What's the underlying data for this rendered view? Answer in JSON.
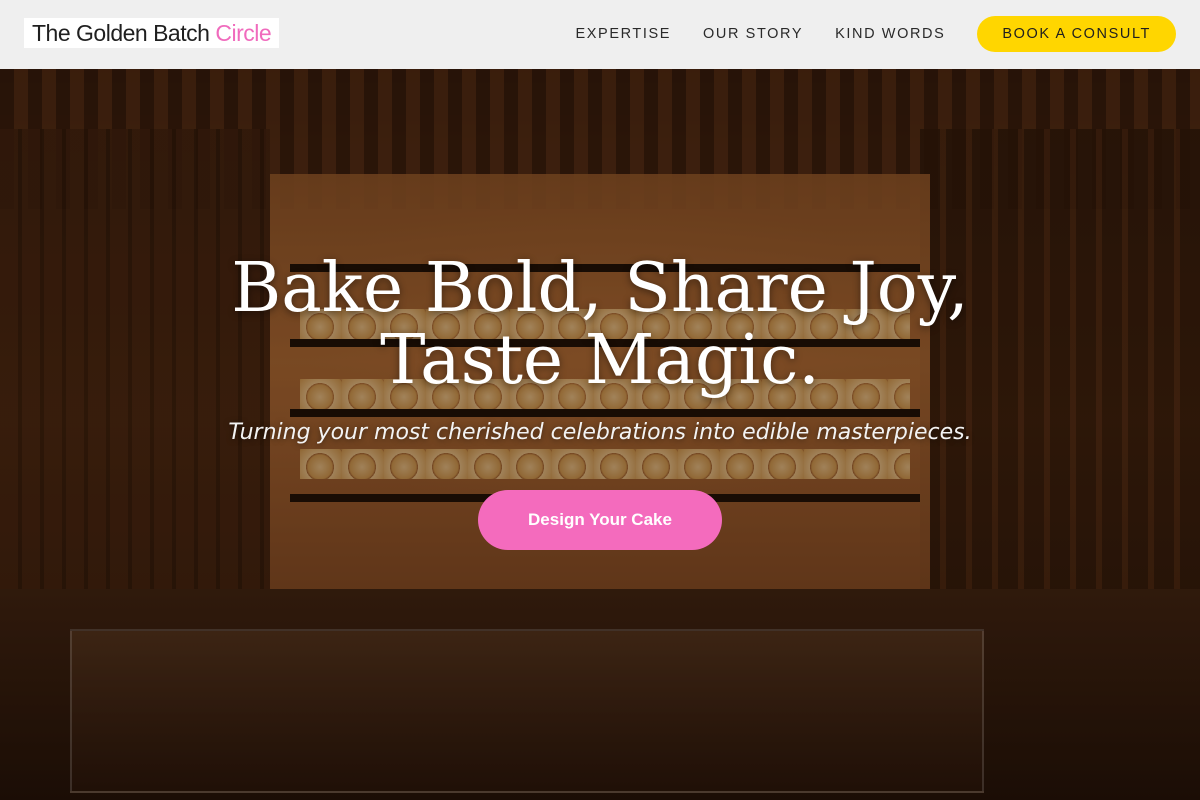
{
  "brand": {
    "name_main": "The Golden Batch",
    "name_accent": "Circle",
    "accent_color": "#f06bbd"
  },
  "nav": {
    "links": [
      {
        "label": "EXPERTISE"
      },
      {
        "label": "OUR STORY"
      },
      {
        "label": "KIND WORDS"
      }
    ],
    "cta_label": "BOOK A CONSULT",
    "cta_color": "#ffd600"
  },
  "hero": {
    "title_line1": "Bake Bold, Share Joy,",
    "title_line2": "Taste Magic.",
    "subtitle": "Turning your most cherished celebrations into edible masterpieces.",
    "cta_label": "Design Your Cake",
    "cta_color": "#f46bbd",
    "background_image": "bakery-interior-photo"
  }
}
